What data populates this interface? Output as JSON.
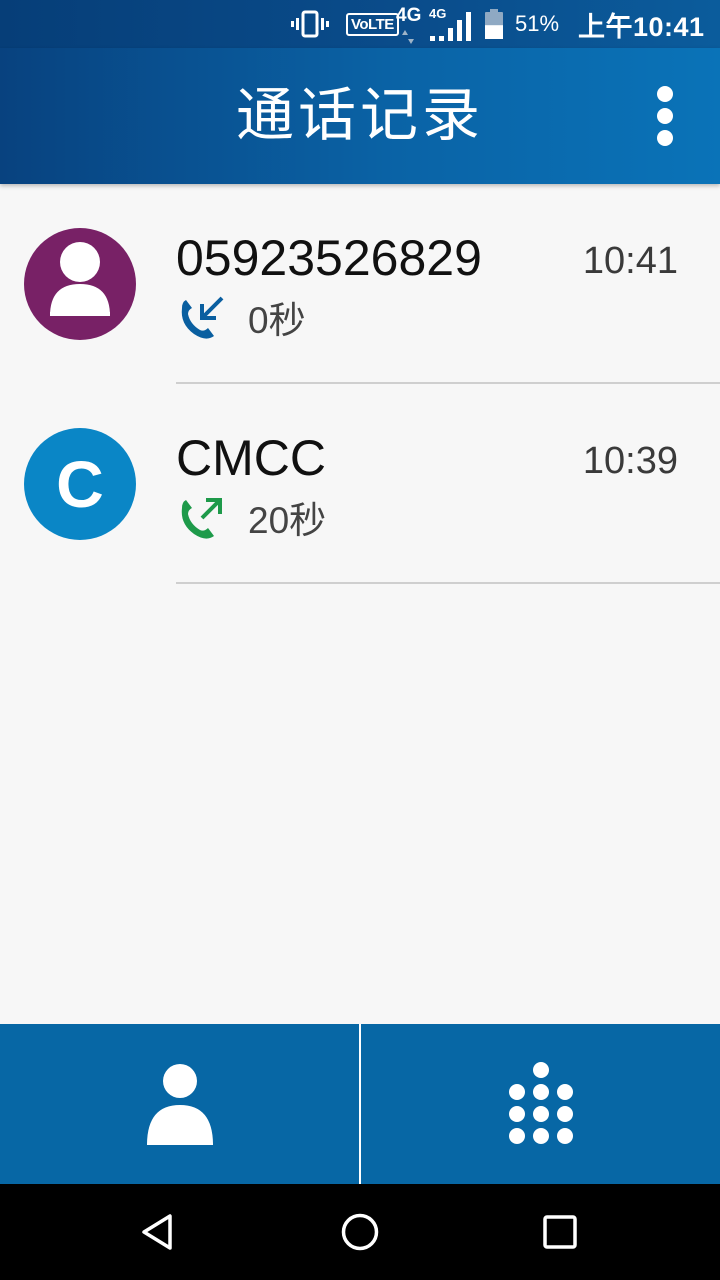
{
  "status_bar": {
    "volte_label": "VoLTE",
    "net1_label": "4G",
    "net2_label": "4G",
    "battery_percent": "51%",
    "battery_level": 0.51,
    "time": "上午10:41",
    "icons": [
      "vibrate-icon",
      "volte-icon",
      "signal-4g-icon",
      "signal-bars-icon",
      "battery-icon"
    ]
  },
  "app_bar": {
    "title": "通话记录",
    "overflow_icon": "more-vertical-icon"
  },
  "calls": [
    {
      "name": "05923526829",
      "time": "10:41",
      "duration": "0秒",
      "type": "incoming",
      "type_icon": "incoming-call-icon",
      "type_color": "#0a5fa0",
      "avatar": "person-icon",
      "avatar_color": "#782166"
    },
    {
      "name": "CMCC",
      "time": "10:39",
      "duration": "20秒",
      "type": "outgoing",
      "type_icon": "outgoing-call-icon",
      "type_color": "#1e9a4a",
      "avatar_letter": "C",
      "avatar_color": "#0a86c6"
    }
  ],
  "bottom_tabs": [
    {
      "icon": "contacts-icon"
    },
    {
      "icon": "dialpad-icon"
    }
  ],
  "nav_bar": {
    "icons": [
      "back-icon",
      "home-icon",
      "recent-apps-icon"
    ]
  },
  "colors": {
    "app_bar": "#0a5c9e",
    "bottom_bar": "#0767a5",
    "background": "#f7f7f7"
  }
}
